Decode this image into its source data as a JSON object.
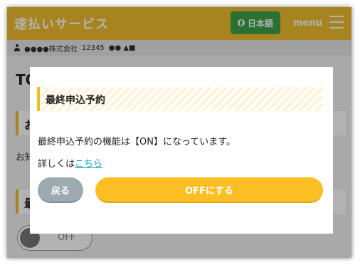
{
  "header": {
    "brand": "速払いサービス",
    "language_button": "日本語",
    "menu_label": "menu"
  },
  "userbar": {
    "company": "●●●●株式会社",
    "code": "12345",
    "name": "●● ▲■"
  },
  "background": {
    "title_fragment": "TO",
    "section1_fragment": "お",
    "text_fragment": "お知",
    "section2_fragment": "最",
    "toggle_label": "OFF"
  },
  "modal": {
    "title": "最終申込予約",
    "body": "最終申込予約の機能は【ON】になっています。",
    "more_prefix": "詳しくは",
    "more_link": "こちら",
    "back_button": "戻る",
    "off_button": "OFFにする"
  },
  "colors": {
    "header": "#f0bd2e",
    "language_button": "#3aa34a",
    "primary_button": "#fbbf24",
    "back_button": "#9eaab2",
    "link": "#1aa3c8"
  }
}
